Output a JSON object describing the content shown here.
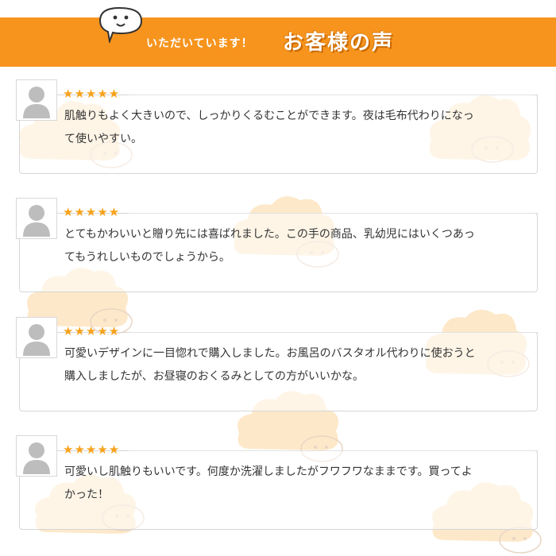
{
  "header": {
    "subtitle": "いただいています！",
    "title": "お客様の声"
  },
  "colors": {
    "banner": "#f7941d",
    "star": "#f7a21b",
    "cloud": "#fde4c0"
  },
  "reviews": [
    {
      "avatar_icon": "user-avatar-icon",
      "stars": "★★★★★",
      "rating": 5,
      "line1": "肌触りもよく大きいので、しっかりくるむことができます。夜は毛布代わりになっ",
      "line2": "て使いやすい。"
    },
    {
      "avatar_icon": "user-avatar-icon",
      "stars": "★★★★★",
      "rating": 5,
      "line1": "とてもかわいいと贈り先には喜ばれました。この手の商品、乳幼児にはいくつあっ",
      "line2": "てもうれしいものでしょうから。"
    },
    {
      "avatar_icon": "user-avatar-icon",
      "stars": "★★★★★",
      "rating": 5,
      "line1": "可愛いデザインに一目惚れで購入しました。お風呂のバスタオル代わりに使おうと",
      "line2": "購入しましたが、お昼寝のおくるみとしての方がいいかな。"
    },
    {
      "avatar_icon": "user-avatar-icon",
      "stars": "★★★★★",
      "rating": 5,
      "line1": "可愛いし肌触りもいいです。何度か洗濯しましたがフワフワなままです。買ってよ",
      "line2": "かった！"
    }
  ]
}
